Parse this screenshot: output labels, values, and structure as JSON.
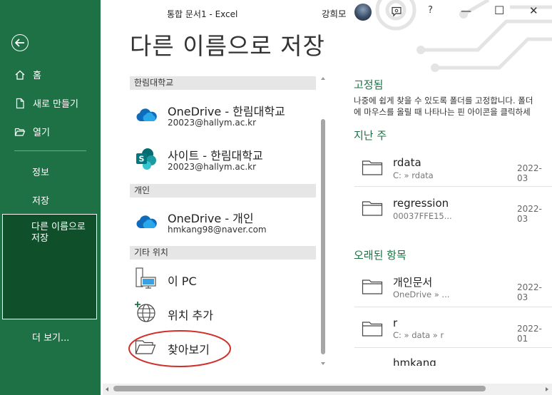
{
  "window": {
    "title": "통합 문서1  -  Excel",
    "user_name": "강희모",
    "help_label": "?",
    "controls": {
      "minimize": "—",
      "maximize": "☐",
      "close": "✕"
    }
  },
  "sidebar": {
    "back_icon": "back-arrow-icon",
    "items": [
      {
        "label": "홈",
        "icon": "home-icon"
      },
      {
        "label": "새로 만들기",
        "icon": "new-document-icon"
      },
      {
        "label": "열기",
        "icon": "open-folder-icon"
      },
      {
        "label": "정보"
      },
      {
        "label": "저장"
      },
      {
        "label": "다른 이름으로\n저장",
        "selected": true
      },
      {
        "label": "더 보기..."
      }
    ]
  },
  "page": {
    "title": "다른 이름으로 저장"
  },
  "locations": {
    "groups": [
      {
        "header": "한림대학교",
        "items": [
          {
            "title": "OneDrive - 한림대학교",
            "subtitle": "20023@hallym.ac.kr",
            "icon": "onedrive-cloud-icon"
          },
          {
            "title": "사이트 - 한림대학교",
            "subtitle": "20023@hallym.ac.kr",
            "icon": "sharepoint-icon"
          }
        ]
      },
      {
        "header": "개인",
        "items": [
          {
            "title": "OneDrive - 개인",
            "subtitle": "hmkang98@naver.com",
            "icon": "onedrive-cloud-icon"
          }
        ]
      },
      {
        "header": "기타 위치",
        "items": [
          {
            "title": "이 PC",
            "icon": "this-pc-icon"
          },
          {
            "title": "위치 추가",
            "icon": "add-location-globe-icon"
          },
          {
            "title": "찾아보기",
            "icon": "browse-folder-icon",
            "highlighted": true
          }
        ]
      }
    ]
  },
  "recent": {
    "pinned": {
      "title": "고정됨",
      "description_line1": "나중에 쉽게 찾을 수 있도록 폴더를 고정합니다. 폴더",
      "description_line2": "에 마우스를 올릴 때 나타나는 핀 아이콘을 클릭하세"
    },
    "last_week": {
      "title": "지난 주",
      "folders": [
        {
          "name": "rdata",
          "path": "C: » rdata",
          "date": "2022-03"
        },
        {
          "name": "regression",
          "path": "00037FFE15...",
          "date": "2022-03"
        }
      ]
    },
    "older": {
      "title": "오래된 항목",
      "folders": [
        {
          "name": "개인문서",
          "path": "OneDrive » ...",
          "date": "2022-03"
        },
        {
          "name": "r",
          "path": "C: » data » r",
          "date": "2022-01"
        },
        {
          "name": "hmkang",
          "path": "",
          "date": ""
        }
      ]
    }
  },
  "colors": {
    "accent": "#1e7145",
    "selected": "#0f4f2a",
    "highlight_ring": "#d0302a"
  }
}
